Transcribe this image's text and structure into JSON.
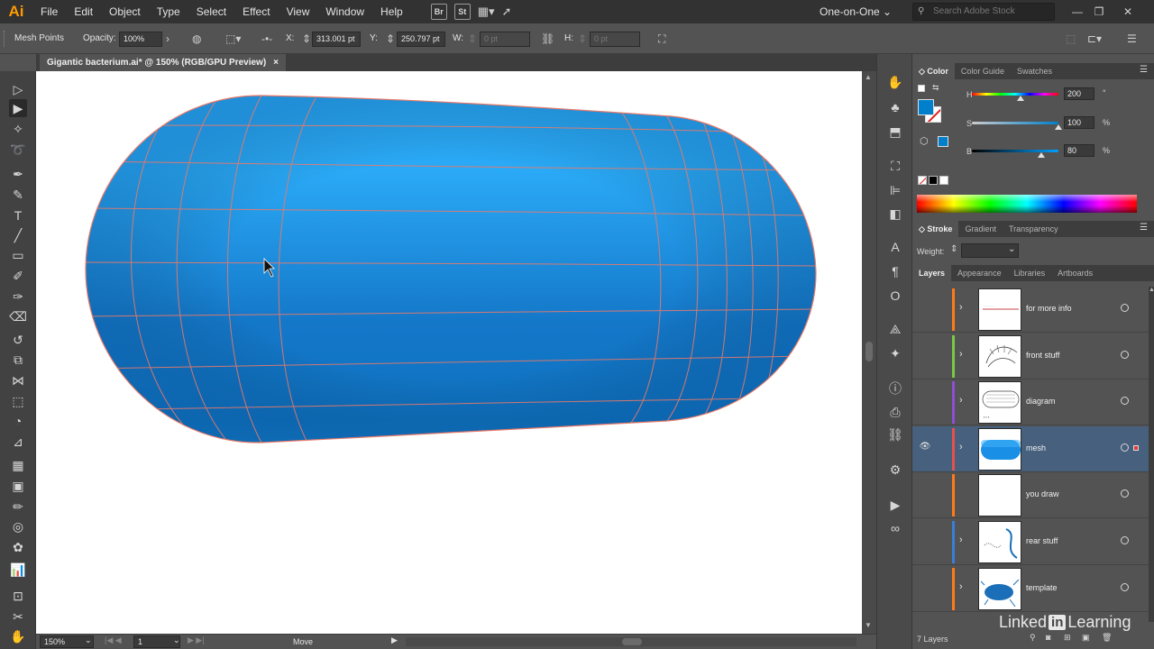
{
  "app": {
    "logo": "Ai"
  },
  "menu": [
    "File",
    "Edit",
    "Object",
    "Type",
    "Select",
    "Effect",
    "View",
    "Window",
    "Help"
  ],
  "bridge": [
    "Br",
    "St"
  ],
  "workspace": {
    "label": "One-on-One"
  },
  "stock_search": {
    "placeholder": "Search Adobe Stock"
  },
  "control": {
    "tool_label": "Mesh Points",
    "opacity_label": "Opacity:",
    "opacity_value": "100%",
    "x_label": "X:",
    "x_value": "313.001 pt",
    "y_label": "Y:",
    "y_value": "250.797 pt",
    "w_label": "W:",
    "w_value": "0 pt",
    "h_label": "H:",
    "h_value": "0 pt"
  },
  "document": {
    "tab_title": "Gigantic bacterium.ai* @ 150% (RGB/GPU Preview)",
    "close": "×"
  },
  "status": {
    "zoom": "150%",
    "artboard": "1",
    "mode": "Move"
  },
  "color_panel": {
    "tabs": [
      "Color",
      "Color Guide",
      "Swatches"
    ],
    "h_label": "H",
    "h_value": "200",
    "h_unit": "°",
    "s_label": "S",
    "s_value": "100",
    "s_unit": "%",
    "b_label": "B",
    "b_value": "80",
    "b_unit": "%",
    "h_fraction": 0.56,
    "s_fraction": 1.0,
    "b_fraction": 0.8,
    "fill_color": "#0080cc"
  },
  "stroke_panel": {
    "tabs": [
      "Stroke",
      "Gradient",
      "Transparency"
    ],
    "weight_label": "Weight:"
  },
  "layers_panel": {
    "tabs": [
      "Layers",
      "Appearance",
      "Libraries",
      "Artboards"
    ],
    "layers": [
      {
        "name": "for more info",
        "color": "#ff7a1a",
        "has_chevron": true,
        "visible": false,
        "selected": false
      },
      {
        "name": "front stuff",
        "color": "#7ac943",
        "has_chevron": true,
        "visible": false,
        "selected": false
      },
      {
        "name": "diagram",
        "color": "#8d4fd8",
        "has_chevron": true,
        "visible": false,
        "selected": false
      },
      {
        "name": "mesh",
        "color": "#e8514a",
        "has_chevron": true,
        "visible": true,
        "selected": true
      },
      {
        "name": "you draw",
        "color": "#ff7a1a",
        "has_chevron": false,
        "visible": false,
        "selected": false
      },
      {
        "name": "rear stuff",
        "color": "#3a7ddb",
        "has_chevron": true,
        "visible": false,
        "selected": false
      },
      {
        "name": "template",
        "color": "#ff7a1a",
        "has_chevron": true,
        "visible": false,
        "selected": false
      }
    ],
    "count_label": "7 Layers"
  },
  "watermark": {
    "pre": "Linked",
    "in": "in",
    "post": "Learning"
  },
  "colors": {
    "mesh_blue": "#1a9cf0",
    "mesh_line": "#e87a6a",
    "selection": "#46607e"
  }
}
